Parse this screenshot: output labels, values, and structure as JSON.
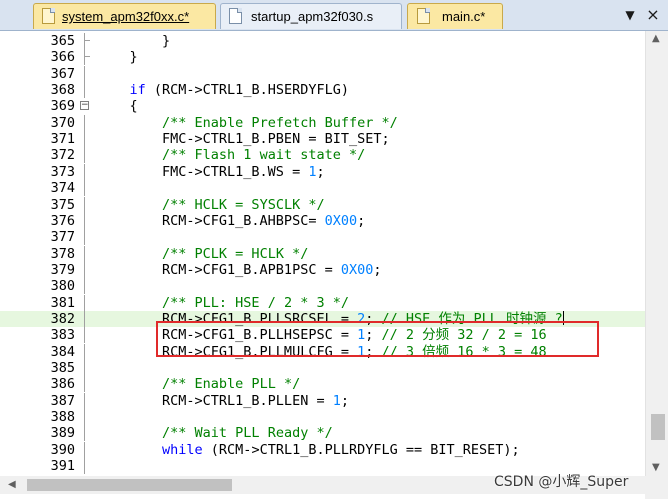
{
  "tabs": [
    {
      "label": "system_apm32f0xx.c*",
      "active": true
    },
    {
      "label": "startup_apm32f030.s",
      "active": false
    },
    {
      "label": "main.c*",
      "active": false
    }
  ],
  "tab_menu": {
    "icon": "chevron-down-icon",
    "glyph": "▼",
    "close_glyph": "×"
  },
  "editor": {
    "lines": [
      {
        "n": "365",
        "parts": [
          {
            "t": "        }",
            "c": "sym"
          }
        ]
      },
      {
        "n": "366",
        "parts": [
          {
            "t": "    }",
            "c": "sym"
          }
        ]
      },
      {
        "n": "367",
        "parts": []
      },
      {
        "n": "368",
        "parts": [
          {
            "t": "    ",
            "c": "sym"
          },
          {
            "t": "if",
            "c": "kw"
          },
          {
            "t": " (RCM->CTRL1_B.HSERDYFLG)",
            "c": "sym"
          }
        ]
      },
      {
        "n": "369",
        "parts": [
          {
            "t": "    {",
            "c": "sym"
          }
        ]
      },
      {
        "n": "370",
        "parts": [
          {
            "t": "        ",
            "c": "sym"
          },
          {
            "t": "/** Enable Prefetch Buffer */",
            "c": "cm"
          }
        ]
      },
      {
        "n": "371",
        "parts": [
          {
            "t": "        FMC->CTRL1_B.PBEN = BIT_SET;",
            "c": "sym"
          }
        ]
      },
      {
        "n": "372",
        "parts": [
          {
            "t": "        ",
            "c": "sym"
          },
          {
            "t": "/** Flash 1 wait state */",
            "c": "cm"
          }
        ]
      },
      {
        "n": "373",
        "parts": [
          {
            "t": "        FMC->CTRL1_B.WS = ",
            "c": "sym"
          },
          {
            "t": "1",
            "c": "num"
          },
          {
            "t": ";",
            "c": "sym"
          }
        ]
      },
      {
        "n": "374",
        "parts": []
      },
      {
        "n": "375",
        "parts": [
          {
            "t": "        ",
            "c": "sym"
          },
          {
            "t": "/** HCLK = SYSCLK */",
            "c": "cm"
          }
        ]
      },
      {
        "n": "376",
        "parts": [
          {
            "t": "        RCM->CFG1_B.AHBPSC= ",
            "c": "sym"
          },
          {
            "t": "0X00",
            "c": "num"
          },
          {
            "t": ";",
            "c": "sym"
          }
        ]
      },
      {
        "n": "377",
        "parts": []
      },
      {
        "n": "378",
        "parts": [
          {
            "t": "        ",
            "c": "sym"
          },
          {
            "t": "/** PCLK = HCLK */",
            "c": "cm"
          }
        ]
      },
      {
        "n": "379",
        "parts": [
          {
            "t": "        RCM->CFG1_B.APB1PSC = ",
            "c": "sym"
          },
          {
            "t": "0X00",
            "c": "num"
          },
          {
            "t": ";",
            "c": "sym"
          }
        ]
      },
      {
        "n": "380",
        "parts": []
      },
      {
        "n": "381",
        "parts": [
          {
            "t": "        ",
            "c": "sym"
          },
          {
            "t": "/** PLL: HSE / 2 * 3 */",
            "c": "cm"
          }
        ]
      },
      {
        "n": "382",
        "parts": [
          {
            "t": "        RCM->CFG1_B.PLLSRCSEL = ",
            "c": "sym"
          },
          {
            "t": "2",
            "c": "num"
          },
          {
            "t": "; ",
            "c": "sym"
          },
          {
            "t": "// HSE 作为 PLL 时钟源 ?",
            "c": "cm"
          }
        ],
        "highlight": true,
        "caret": true
      },
      {
        "n": "383",
        "parts": [
          {
            "t": "        RCM->CFG1_B.PLLHSEPSC = ",
            "c": "sym"
          },
          {
            "t": "1",
            "c": "num"
          },
          {
            "t": "; ",
            "c": "sym"
          },
          {
            "t": "// 2 分频 32 / 2 = 16",
            "c": "cm"
          }
        ]
      },
      {
        "n": "384",
        "parts": [
          {
            "t": "        RCM->CFG1_B.PLLMULCFG = ",
            "c": "sym"
          },
          {
            "t": "1",
            "c": "num"
          },
          {
            "t": "; ",
            "c": "sym"
          },
          {
            "t": "// 3 倍频 16 * 3 = 48",
            "c": "cm"
          }
        ]
      },
      {
        "n": "385",
        "parts": []
      },
      {
        "n": "386",
        "parts": [
          {
            "t": "        ",
            "c": "sym"
          },
          {
            "t": "/** Enable PLL */",
            "c": "cm"
          }
        ]
      },
      {
        "n": "387",
        "parts": [
          {
            "t": "        RCM->CTRL1_B.PLLEN = ",
            "c": "sym"
          },
          {
            "t": "1",
            "c": "num"
          },
          {
            "t": ";",
            "c": "sym"
          }
        ]
      },
      {
        "n": "388",
        "parts": []
      },
      {
        "n": "389",
        "parts": [
          {
            "t": "        ",
            "c": "sym"
          },
          {
            "t": "/** Wait PLL Ready */",
            "c": "cm"
          }
        ]
      },
      {
        "n": "390",
        "parts": [
          {
            "t": "        ",
            "c": "sym"
          },
          {
            "t": "while",
            "c": "kw"
          },
          {
            "t": " (RCM->CTRL1_B.PLLRDYFLG == BIT_RESET);",
            "c": "sym"
          }
        ]
      },
      {
        "n": "391",
        "parts": []
      }
    ],
    "fold_marker_line": "369",
    "fold_open_glyph": "−"
  },
  "scroll": {
    "up_arrow": "▲",
    "down_arrow": "▼",
    "left_arrow": "◀",
    "right_arrow": "▶",
    "vertical_position_fraction": 0.86
  },
  "watermark": "CSDN @小辉_Super",
  "colors": {
    "comment": "#008000",
    "keyword": "#0000ff",
    "number": "#0080ff",
    "highlight_box": "#e02a2a",
    "current_line": "#e6f7df",
    "active_tab": "#fbe8a3"
  }
}
